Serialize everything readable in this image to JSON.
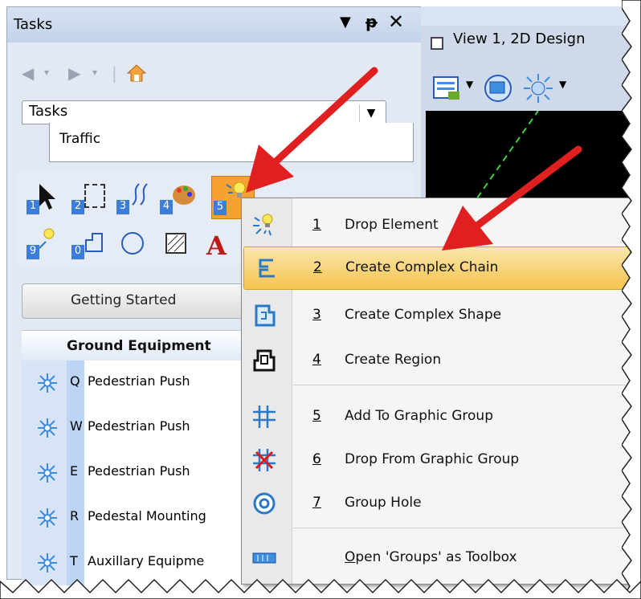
{
  "tasks_panel": {
    "title": "Tasks",
    "pin_glyph": "↓ ᴘ",
    "close_glyph": "✕",
    "nav": {
      "back_icon": "back-arrow-icon",
      "forward_icon": "forward-arrow-icon",
      "home_icon": "home-icon"
    },
    "dropdown": {
      "value": "Tasks",
      "arrow": "▼"
    },
    "category": "Traffic",
    "toolbox_keys": [
      "1",
      "2",
      "3",
      "4",
      "5",
      "9",
      "0"
    ],
    "getting_started": "Getting Started",
    "group_header": "Ground Equipment",
    "items": [
      {
        "key": "Q",
        "label": "Pedestrian Push"
      },
      {
        "key": "W",
        "label": "Pedestrian Push"
      },
      {
        "key": "E",
        "label": "Pedestrian Push"
      },
      {
        "key": "R",
        "label": "Pedestal Mounting"
      },
      {
        "key": "T",
        "label": "Auxillary Equipme"
      }
    ]
  },
  "view_panel": {
    "tab_title": "View 1, 2D Design"
  },
  "context_menu": {
    "items": [
      {
        "num": "1",
        "label": "Drop Element",
        "icon": "drop-element-icon"
      },
      {
        "num": "2",
        "label": "Create Complex Chain",
        "icon": "complex-chain-icon",
        "highlighted": true
      },
      {
        "num": "3",
        "label": "Create Complex Shape",
        "icon": "complex-shape-icon"
      },
      {
        "num": "4",
        "label": "Create Region",
        "icon": "region-icon"
      },
      {
        "num": "5",
        "label": "Add To Graphic Group",
        "icon": "graphic-group-icon"
      },
      {
        "num": "6",
        "label": "Drop From Graphic Group",
        "icon": "drop-graphic-group-icon"
      },
      {
        "num": "7",
        "label": "Group Hole",
        "icon": "group-hole-icon"
      },
      {
        "num": "",
        "label": "Open 'Groups' as Toolbox",
        "icon": "toolbox-icon"
      }
    ]
  },
  "colors": {
    "highlight": "#f5c44d",
    "arrow": "#e02020",
    "icon_blue": "#2a78c8"
  }
}
